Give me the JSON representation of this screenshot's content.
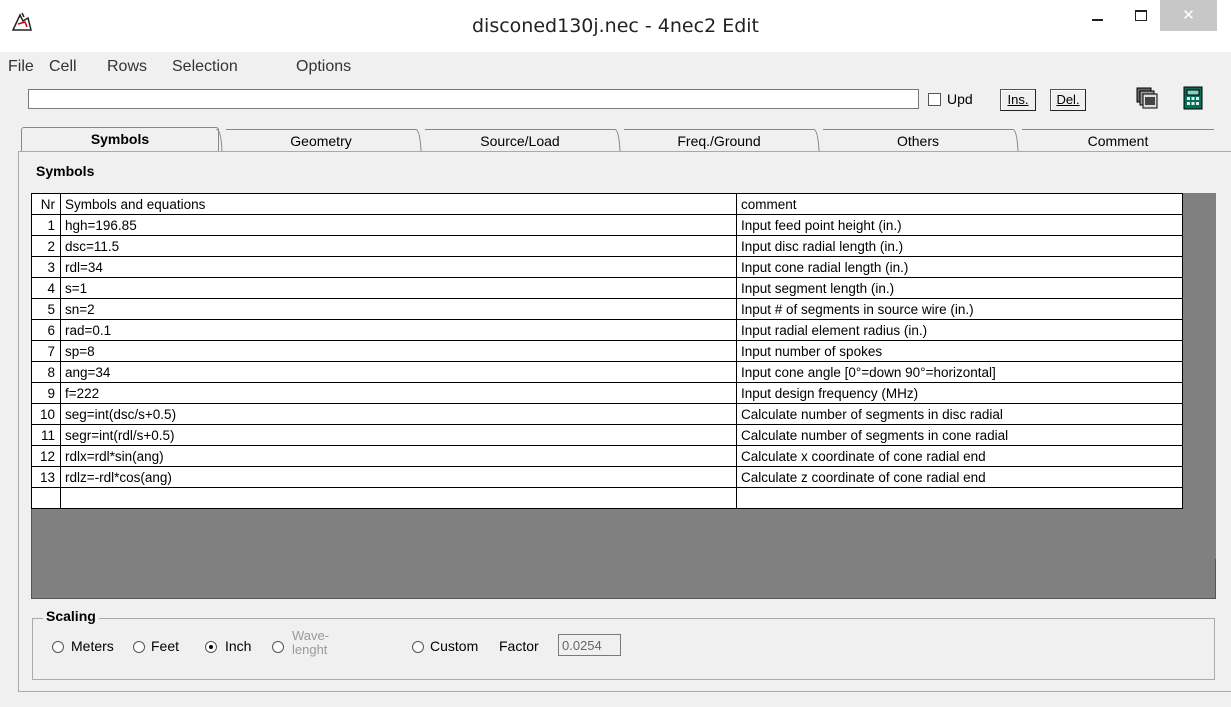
{
  "window": {
    "title": "disconed130j.nec - 4nec2 Edit",
    "close_glyph": "✕"
  },
  "menu": {
    "items": [
      "File",
      "Cell",
      "Rows",
      "Selection",
      "Options"
    ]
  },
  "toolbar": {
    "edit_value": "",
    "upd_label": "Upd",
    "upd_checked": false,
    "ins_label": "Ins.",
    "del_label": "Del."
  },
  "tabs": [
    "Symbols",
    "Geometry",
    "Source/Load",
    "Freq./Ground",
    "Others",
    "Comment"
  ],
  "active_tab": "Symbols",
  "section_title": "Symbols",
  "table": {
    "headers": [
      "Nr",
      "Symbols and equations",
      "comment"
    ],
    "rows": [
      {
        "nr": "1",
        "eq": "hgh=196.85",
        "comment": "Input feed point height (in.)"
      },
      {
        "nr": "2",
        "eq": "dsc=11.5",
        "comment": "Input disc radial length (in.)"
      },
      {
        "nr": "3",
        "eq": "rdl=34",
        "comment": "Input cone radial length (in.)"
      },
      {
        "nr": "4",
        "eq": "s=1",
        "comment": "Input segment length (in.)"
      },
      {
        "nr": "5",
        "eq": "sn=2",
        "comment": "Input # of segments in source wire  (in.)"
      },
      {
        "nr": "6",
        "eq": "rad=0.1",
        "comment": "Input radial element radius (in.)"
      },
      {
        "nr": "7",
        "eq": "sp=8",
        "comment": "Input number of spokes"
      },
      {
        "nr": "8",
        "eq": "ang=34",
        "comment": "Input cone angle [0°=down 90°=horizontal]"
      },
      {
        "nr": "9",
        "eq": "f=222",
        "comment": "Input design frequency (MHz)"
      },
      {
        "nr": "10",
        "eq": "seg=int(dsc/s+0.5)",
        "comment": "Calculate number of segments in disc radial"
      },
      {
        "nr": "11",
        "eq": "segr=int(rdl/s+0.5)",
        "comment": "Calculate number of segments in cone radial"
      },
      {
        "nr": "12",
        "eq": "rdlx=rdl*sin(ang)",
        "comment": "Calculate x coordinate of cone radial end"
      },
      {
        "nr": "13",
        "eq": "rdlz=-rdl*cos(ang)",
        "comment": "Calculate z coordinate of cone radial end"
      },
      {
        "nr": "",
        "eq": "",
        "comment": ""
      }
    ]
  },
  "scaling": {
    "title": "Scaling",
    "options": [
      "Meters",
      "Feet",
      "Inch",
      "Wave-\nlenght",
      "Custom"
    ],
    "selected": "Inch",
    "factor_label": "Factor",
    "factor_value": "0.0254"
  }
}
